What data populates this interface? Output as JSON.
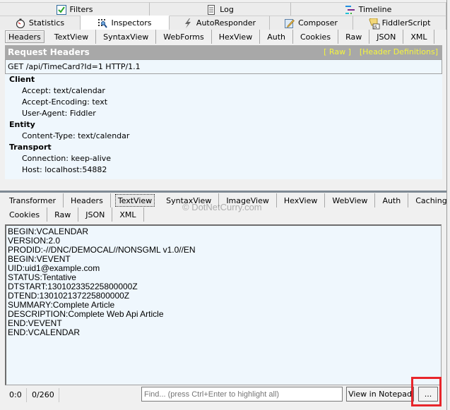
{
  "top_tabs_row1": [
    {
      "label": "Filters",
      "icon": "checkbox-checked-icon"
    },
    {
      "label": "Log",
      "icon": "document-icon"
    },
    {
      "label": "Timeline",
      "icon": "timeline-icon"
    }
  ],
  "top_tabs_row2": [
    {
      "label": "Statistics",
      "icon": "stopwatch-icon"
    },
    {
      "label": "Inspectors",
      "icon": "inspector-icon",
      "active": true
    },
    {
      "label": "AutoResponder",
      "icon": "lightning-icon"
    },
    {
      "label": "Composer",
      "icon": "compose-icon"
    },
    {
      "label": "FiddlerScript",
      "icon": "script-icon"
    }
  ],
  "request_tabs": [
    "Headers",
    "TextView",
    "SyntaxView",
    "WebForms",
    "HexView",
    "Auth",
    "Cookies",
    "Raw",
    "JSON",
    "XML"
  ],
  "request_tabs_selected": "Headers",
  "request_headers": {
    "title": "Request Headers",
    "raw_link": "[ Raw ]",
    "definitions_link": "[Header Definitions]",
    "request_line": "GET /api/TimeCard?Id=1 HTTP/1.1",
    "groups": [
      {
        "name": "Client",
        "items": [
          "Accept: text/calendar",
          "Accept-Encoding: text",
          "User-Agent: Fiddler"
        ]
      },
      {
        "name": "Entity",
        "items": [
          "Content-Type: text/calendar"
        ]
      },
      {
        "name": "Transport",
        "items": [
          "Connection: keep-alive",
          "Host: localhost:54882"
        ]
      }
    ]
  },
  "response_tabs_row1": [
    "Transformer",
    "Headers",
    "TextView",
    "SyntaxView",
    "ImageView",
    "HexView",
    "WebView",
    "Auth",
    "Caching"
  ],
  "response_tabs_row2": [
    "Cookies",
    "Raw",
    "JSON",
    "XML"
  ],
  "response_tabs_selected": "TextView",
  "watermark": "© DotNetCurry.com",
  "response_body": [
    "BEGIN:VCALENDAR",
    "VERSION:2.0",
    "PRODID:-//DNC/DEMOCAL//NONSGML v1.0//EN",
    "BEGIN:VEVENT",
    "UID:uid1@example.com",
    "STATUS:Tentative",
    "DTSTART:130102335225800000Z",
    "DTEND:130102137225800000Z",
    "SUMMARY:Complete Article",
    "DESCRIPTION:Complete Web Api Article",
    "END:VEVENT",
    "END:VCALENDAR"
  ],
  "status": {
    "position": "0:0",
    "count": "0/260",
    "find_placeholder": "Find... (press Ctrl+Enter to highlight all)",
    "view_notepad": "View in Notepad",
    "more": "..."
  },
  "colors": {
    "header_bar": "#a8a8a8",
    "link_yellow": "#f5f53c",
    "panel_bg": "#eff7fd",
    "highlight_red": "#e8262b"
  }
}
